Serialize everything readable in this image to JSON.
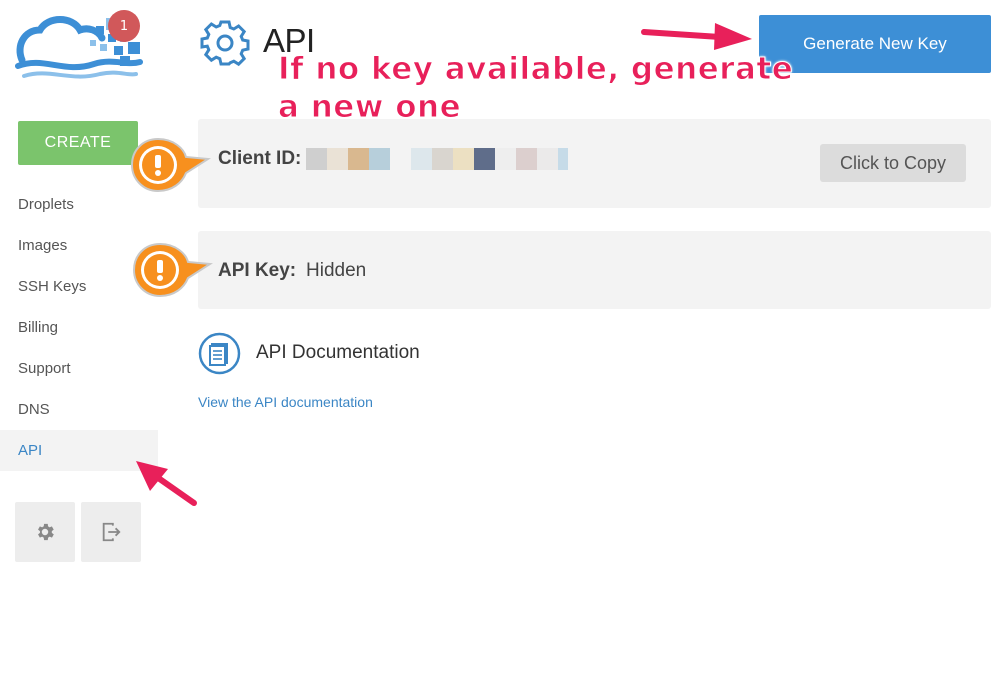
{
  "sidebar": {
    "notification_count": "1",
    "create_label": "CREATE",
    "items": [
      {
        "label": "Droplets"
      },
      {
        "label": "Images"
      },
      {
        "label": "SSH Keys"
      },
      {
        "label": "Billing"
      },
      {
        "label": "Support"
      },
      {
        "label": "DNS"
      },
      {
        "label": "API",
        "active": true
      }
    ],
    "settings_icon": "gear-icon",
    "logout_icon": "logout-icon"
  },
  "header": {
    "title": "API",
    "icon": "gear-icon",
    "generate_button": "Generate New Key"
  },
  "annotation": {
    "text": "If no key available, generate\na new one",
    "color": "#e8205a"
  },
  "client": {
    "label": "Client ID:",
    "value_obscured": true,
    "copy_button": "Click to Copy"
  },
  "api_key": {
    "label": "API Key:",
    "value": "Hidden"
  },
  "docs": {
    "title": "API Documentation",
    "link": "View the API documentation",
    "icon": "document-icon"
  },
  "colors": {
    "accent_blue": "#3d8fd6",
    "create_green": "#7bc46c",
    "warning_orange": "#f7901e",
    "notification_red": "#d1585a",
    "panel_bg": "#f3f3f3"
  }
}
